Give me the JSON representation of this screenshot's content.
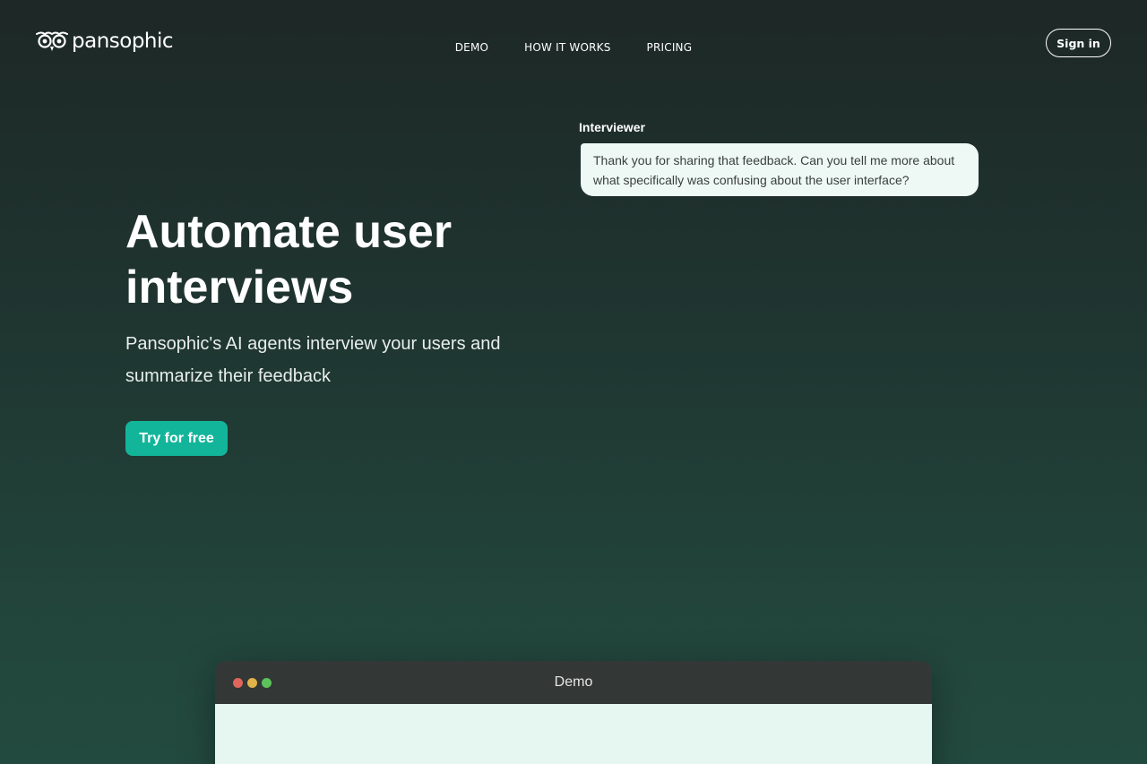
{
  "brand": {
    "name": "pansophic",
    "icon": "owl-icon"
  },
  "nav": [
    {
      "label": "DEMO"
    },
    {
      "label": "HOW IT WORKS"
    },
    {
      "label": "PRICING"
    }
  ],
  "header": {
    "signin_label": "Sign in"
  },
  "hero": {
    "title": "Automate user interviews",
    "subtitle": "Pansophic's AI agents interview your users and summarize their feedback",
    "cta_label": "Try for free"
  },
  "chat": {
    "speaker": "Interviewer",
    "message": "Thank you for sharing that feedback. Can you tell me more about what specifically was confusing about the user interface?"
  },
  "demo": {
    "title": "Demo"
  },
  "colors": {
    "accent": "#13b59a",
    "bubble": "#eef9f5",
    "window_bar": "#333836",
    "window_body": "#e6f6f0"
  }
}
